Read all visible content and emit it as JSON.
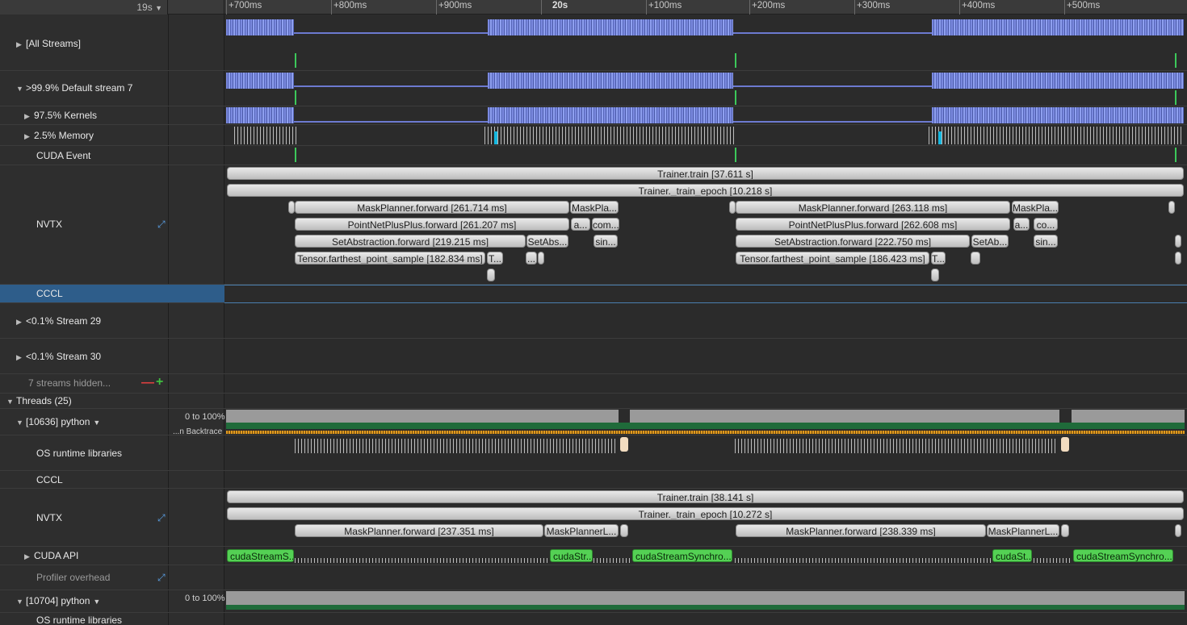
{
  "ruler": {
    "zoom": "19s",
    "ticks": [
      {
        "label": "+700ms",
        "bold": false
      },
      {
        "label": "+800ms",
        "bold": false
      },
      {
        "label": "+900ms",
        "bold": false
      },
      {
        "label": "20s",
        "bold": true
      },
      {
        "label": "+100ms",
        "bold": false
      },
      {
        "label": "+200ms",
        "bold": false
      },
      {
        "label": "+300ms",
        "bold": false
      },
      {
        "label": "+400ms",
        "bold": false
      },
      {
        "label": "+500ms",
        "bold": false
      }
    ]
  },
  "rows": {
    "all_streams": "[All Streams]",
    "default_stream": ">99.9% Default stream 7",
    "kernels": "97.5% Kernels",
    "memory": "2.5% Memory",
    "cuda_event": "CUDA Event",
    "nvtx": "NVTX",
    "cccl": "CCCL",
    "stream29": "<0.1% Stream 29",
    "stream30": "<0.1% Stream 30",
    "hidden": "7 streams hidden...",
    "threads": "Threads (25)",
    "thread1": "[10636] python",
    "thread1_range": "0 to 100%",
    "thread1_backtrace": "...n Backtrace",
    "os_runtime": "OS runtime libraries",
    "cccl2": "CCCL",
    "nvtx2": "NVTX",
    "cuda_api": "CUDA API",
    "profiler_overhead": "Profiler overhead",
    "thread2": "[10704] python",
    "thread2_range": "0 to 100%",
    "os_runtime2": "OS runtime libraries"
  },
  "nvtx_stream": {
    "train": "Trainer.train [37.611 s]",
    "epoch": "Trainer._train_epoch [10.218 s]",
    "mp1": "MaskPlanner.forward [261.714 ms]",
    "mp1b": "MaskPla...",
    "pn1": "PointNetPlusPlus.forward [261.207 ms]",
    "pn1b": "a...",
    "pn1c": "com...",
    "sa1": "SetAbstraction.forward [219.215 ms]",
    "sa1b": "SetAbs...",
    "sa1c": "sin...",
    "fps1": "Tensor.farthest_point_sample [182.834 ms]",
    "fps1b": "T...",
    "fps1c": "...",
    "mp2": "MaskPlanner.forward [263.118 ms]",
    "mp2b": "MaskPla...",
    "pn2": "PointNetPlusPlus.forward [262.608 ms]",
    "pn2b": "a...",
    "pn2c": "co...",
    "sa2": "SetAbstraction.forward [222.750 ms]",
    "sa2b": "SetAb...",
    "sa2c": "sin...",
    "fps2": "Tensor.farthest_point_sample [186.423 ms]",
    "fps2b": "T..."
  },
  "nvtx_thread": {
    "train": "Trainer.train [38.141 s]",
    "epoch": "Trainer._train_epoch [10.272 s]",
    "mp1": "MaskPlanner.forward [237.351 ms]",
    "mp1b": "MaskPlannerL...",
    "mp2": "MaskPlanner.forward [238.339 ms]",
    "mp2b": "MaskPlannerL..."
  },
  "cuda_api": {
    "a1": "cudaStreamS...",
    "a2": "cudaStr...",
    "a3": "cudaStreamSynchro...",
    "a4": "cudaSt...",
    "a5": "cudaStreamSynchro..."
  },
  "colors": {
    "kernel": "#7b8ae0",
    "selected": "#2e5d8a",
    "cuda_api": "#54d154",
    "memory": "#15b8e0"
  }
}
